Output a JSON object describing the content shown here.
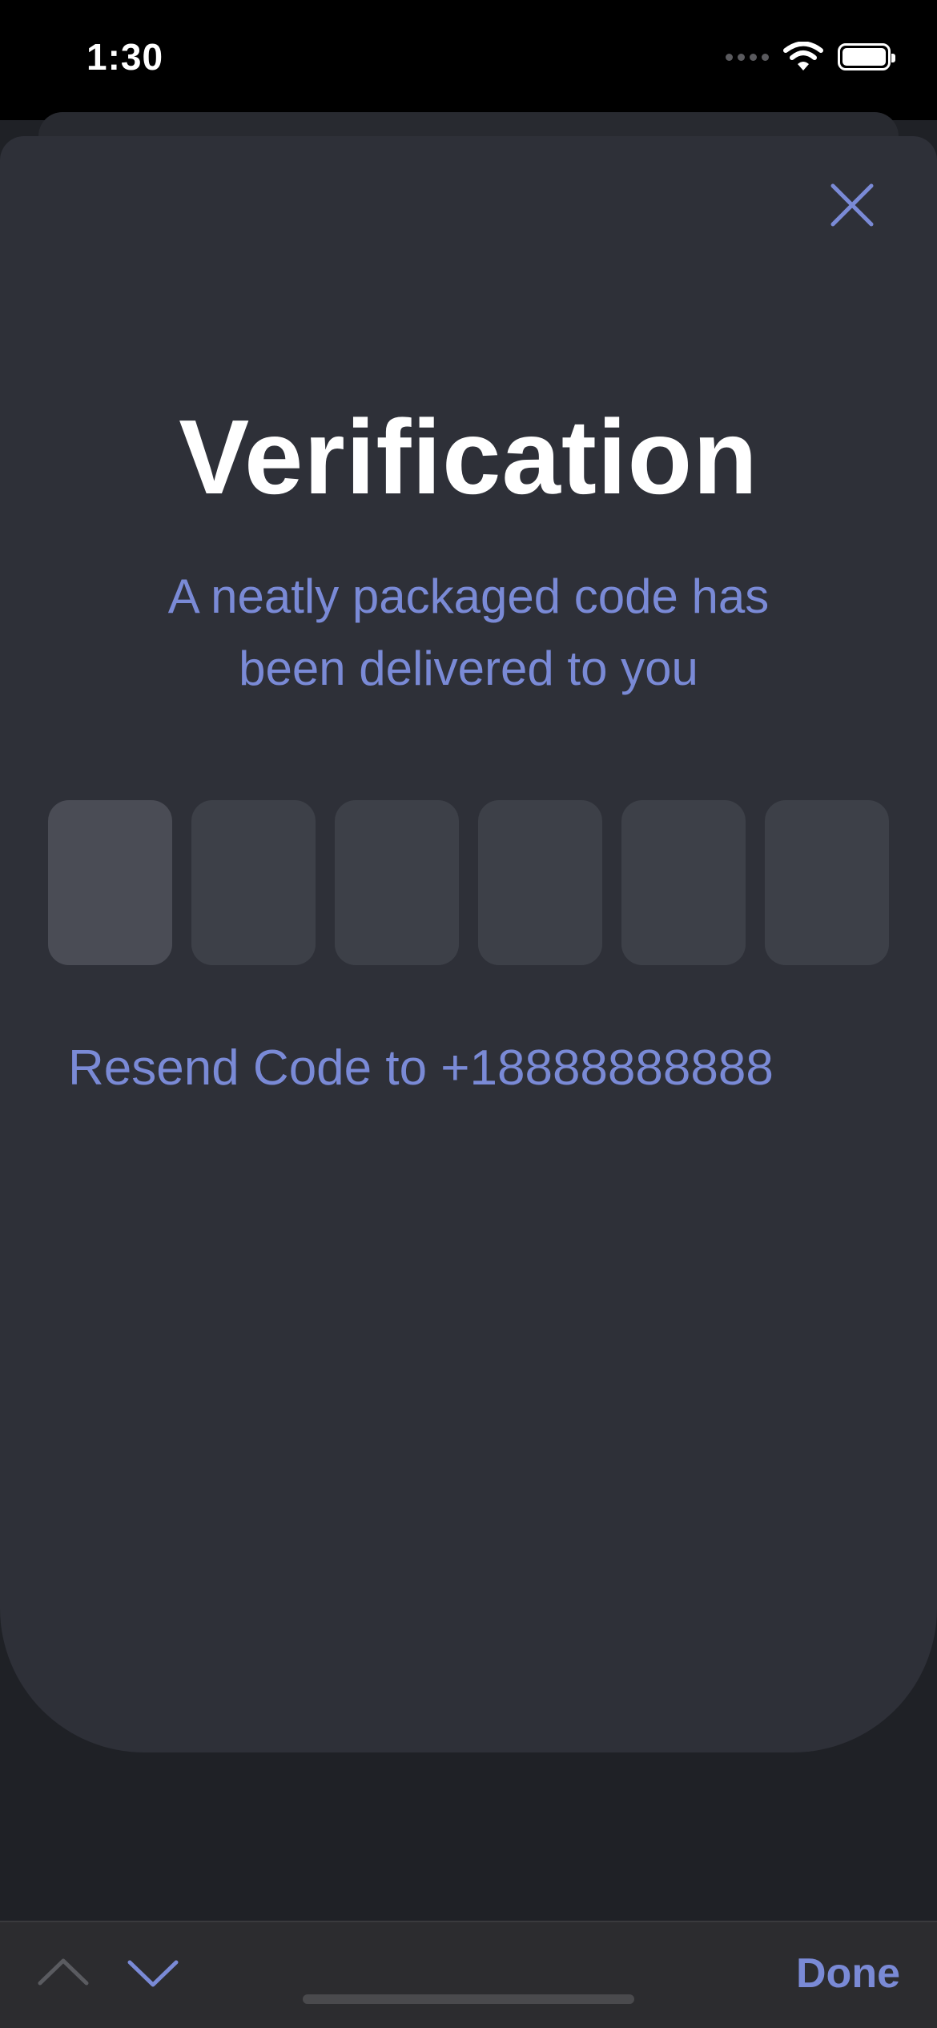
{
  "status_bar": {
    "time": "1:30"
  },
  "verification": {
    "title": "Verification",
    "subtitle": "A neatly packaged code has been delivered to you",
    "code_digits": [
      "",
      "",
      "",
      "",
      "",
      ""
    ],
    "resend_label": "Resend Code to +18888888888"
  },
  "toolbar": {
    "done_label": "Done"
  },
  "colors": {
    "accent": "#7a8ad6",
    "sheet": "#2e3038",
    "box": "#3d4048"
  }
}
